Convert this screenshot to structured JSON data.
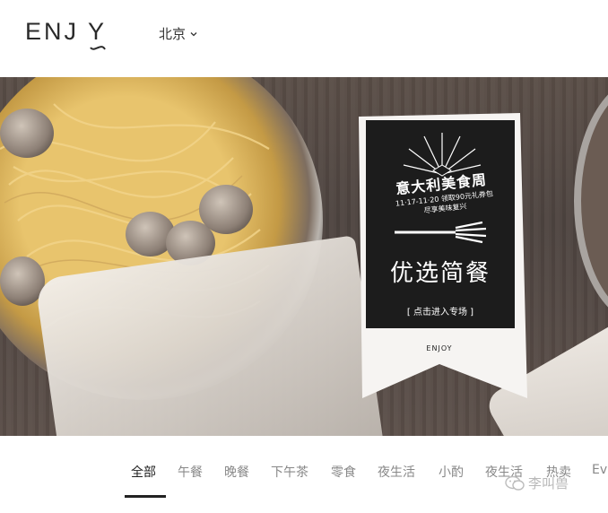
{
  "header": {
    "logo": "ENJ Y",
    "city": "北京"
  },
  "banner": {
    "card": {
      "promo_title": "意大利美食周",
      "promo_sub_line1": "11·17-11·20 领取90元礼券包",
      "promo_sub_line2": "尽享美味复兴",
      "headline": "优选简餐",
      "cta": "[ 点击进入专场 ]",
      "logo": "ENJOY"
    }
  },
  "tabs": {
    "items": [
      {
        "label": "全部",
        "active": true
      },
      {
        "label": "午餐",
        "active": false
      },
      {
        "label": "晚餐",
        "active": false
      },
      {
        "label": "下午茶",
        "active": false
      },
      {
        "label": "零食",
        "active": false
      },
      {
        "label": "夜生活",
        "active": false
      },
      {
        "label": "小酌",
        "active": false
      },
      {
        "label": "夜生活",
        "active": false
      },
      {
        "label": "热卖",
        "active": false
      },
      {
        "label": "Ev",
        "active": false
      }
    ]
  },
  "watermark": {
    "text": "李叫兽",
    "icon": "wechat-icon"
  },
  "colors": {
    "active_tab": "#222222",
    "inactive_tab": "#888888",
    "card_black": "#1c1c1c"
  }
}
